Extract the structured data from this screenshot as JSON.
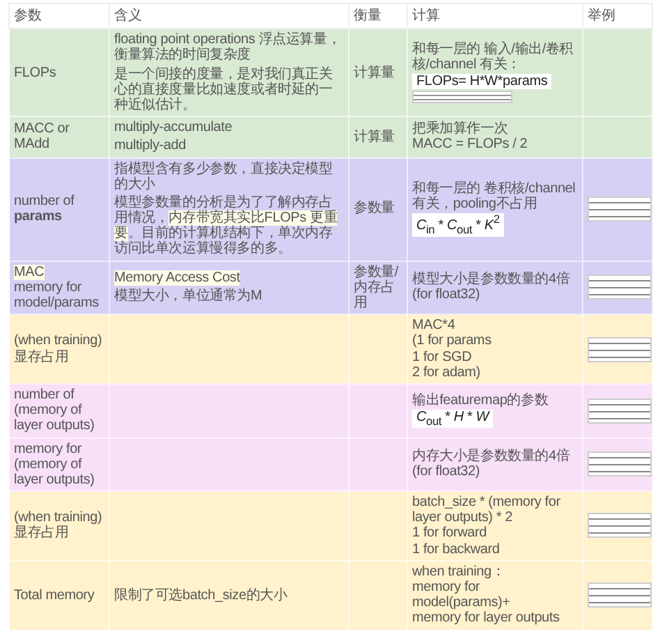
{
  "table": {
    "columns": [
      "参数",
      "含义",
      "衡量",
      "计算",
      "举例"
    ],
    "rows": [
      {
        "color": "#d9ead3",
        "param": [
          [
            {
              "text": "FLOPs",
              "highlight": false
            }
          ]
        ],
        "meaning": [
          [
            {
              "text": "floating point operations 浮点运算量，衡量算法的时间复杂度",
              "highlight": false
            }
          ],
          [
            {
              "text": "是一个间接的度量，是对我们真正关心的直接度量比如速度或者时延的一种近似估计。",
              "highlight": false
            }
          ]
        ],
        "measure": "计算量",
        "calc": [
          {
            "kind": "text",
            "text": "和每一层的 输入/输出/卷积核/channel 有关："
          },
          {
            "kind": "formula",
            "text": "FLOPs= H*W*params"
          },
          {
            "kind": "image"
          }
        ],
        "example_image": false
      },
      {
        "color": "#d9ead3",
        "param": [
          [
            {
              "text": "MACC or MAdd",
              "highlight": false
            }
          ]
        ],
        "meaning": [
          [
            {
              "text": "multiply-accumulate",
              "highlight": false
            }
          ],
          [
            {
              "text": "multiply-add",
              "highlight": false
            }
          ]
        ],
        "measure": "计算量",
        "calc": [
          {
            "kind": "text",
            "text": "把乘加算作一次"
          },
          {
            "kind": "text",
            "text": "MACC = FLOPs / 2"
          }
        ],
        "example_image": false
      },
      {
        "color": "#d6d0f4",
        "param": [
          [
            {
              "text": "number of **params**",
              "highlight": false
            }
          ]
        ],
        "meaning": [
          [
            {
              "text": "指模型含有多少参数，直接决定模型的大小",
              "highlight": false
            }
          ],
          [
            {
              "text": "模型参数量的分析是为了了解内存占用情况，",
              "highlight": false
            },
            {
              "text": "内存带宽其实比FLOPs 更重要",
              "highlight": true
            },
            {
              "text": "。目前的计算机结构下，单次内存访问比单次运算慢得多的多。",
              "highlight": false
            }
          ]
        ],
        "measure": "参数量",
        "calc": [
          {
            "kind": "text",
            "text": "和每一层的 卷积核/channel有关，pooling不占用"
          },
          {
            "kind": "formula",
            "text": "*C*$_{in}$ * *C*$_{out}$ * *K*$^{2}$"
          }
        ],
        "example_image": true
      },
      {
        "color": "#d6d0f4",
        "param": [
          [
            {
              "text": "MAC",
              "highlight": true
            }
          ],
          [
            {
              "text": "memory for model/params",
              "highlight": false
            }
          ]
        ],
        "meaning": [
          [
            {
              "text": "Memory Access Cost",
              "highlight": true
            }
          ],
          [
            {
              "text": "模型大小，单位通常为M",
              "highlight": false
            }
          ]
        ],
        "measure": "参数量/内存占用",
        "calc": [
          {
            "kind": "text",
            "text": "模型大小是参数数量的4倍"
          },
          {
            "kind": "text",
            "text": "(for float32)"
          }
        ],
        "example_image": true
      },
      {
        "color": "#fff2cc",
        "param": [
          [
            {
              "text": "(when training)显存占用",
              "highlight": false
            }
          ]
        ],
        "meaning": [],
        "measure": "",
        "calc": [
          {
            "kind": "text",
            "text": "MAC*4"
          },
          {
            "kind": "text",
            "text": "(1 for params"
          },
          {
            "kind": "text",
            "text": "1 for SGD"
          },
          {
            "kind": "text",
            "text": "2 for adam)"
          }
        ],
        "example_image": true
      },
      {
        "color": "#f8e0f8",
        "param": [
          [
            {
              "text": "number of (memory of layer outputs)",
              "highlight": false
            }
          ]
        ],
        "meaning": [],
        "measure": "",
        "calc": [
          {
            "kind": "text",
            "text": "输出featuremap的参数"
          },
          {
            "kind": "formula",
            "text": "*C*$_{out}$ * *H* * *W*"
          }
        ],
        "example_image": true
      },
      {
        "color": "#f8e0f8",
        "param": [
          [
            {
              "text": "memory for  (memory of layer outputs)",
              "highlight": false
            }
          ]
        ],
        "meaning": [],
        "measure": "",
        "calc": [
          {
            "kind": "text",
            "text": "内存大小是参数数量的4倍"
          },
          {
            "kind": "text",
            "text": "(for float32)"
          }
        ],
        "example_image": true
      },
      {
        "color": "#fff2cc",
        "param": [
          [
            {
              "text": "(when training)显存占用",
              "highlight": false
            }
          ]
        ],
        "meaning": [],
        "measure": "",
        "calc": [
          {
            "kind": "text",
            "text": "batch_size * (memory for layer outputs) * 2"
          },
          {
            "kind": "text",
            "text": "1 for forward"
          },
          {
            "kind": "text",
            "text": "1 for backward"
          }
        ],
        "example_image": true
      },
      {
        "color": "#fff2cc",
        "param": [
          [
            {
              "text": "Total memory",
              "highlight": false
            }
          ]
        ],
        "meaning": [
          [
            {
              "text": "限制了可选batch_size的大小",
              "highlight": false
            }
          ]
        ],
        "measure": "",
        "calc": [
          {
            "kind": "text",
            "text": "when training："
          },
          {
            "kind": "text",
            "text": "memory for model(params)+"
          },
          {
            "kind": "text",
            "text": "memory for layer outputs"
          }
        ],
        "example_image": true
      }
    ]
  }
}
